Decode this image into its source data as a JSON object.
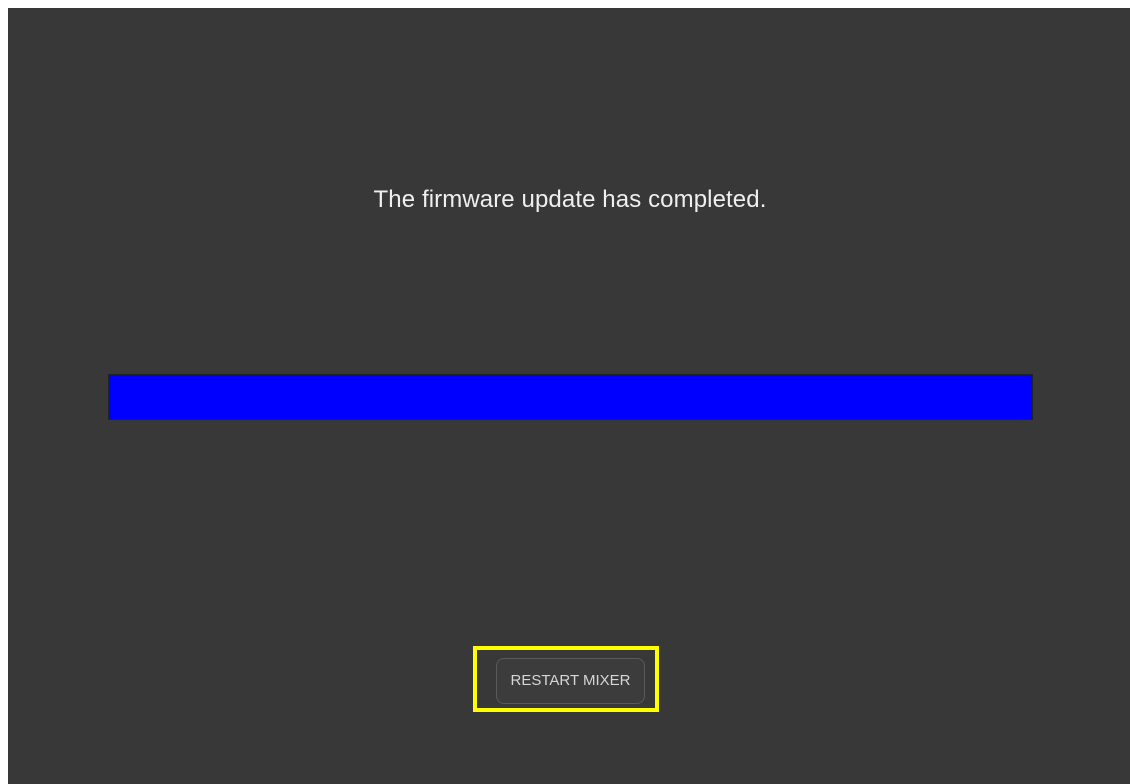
{
  "screen": {
    "message": "The firmware update has completed.",
    "progress_percent": 100,
    "progress_color": "#0000ff",
    "highlight_color": "#ffff00"
  },
  "actions": {
    "restart_label": "RESTART MIXER"
  }
}
